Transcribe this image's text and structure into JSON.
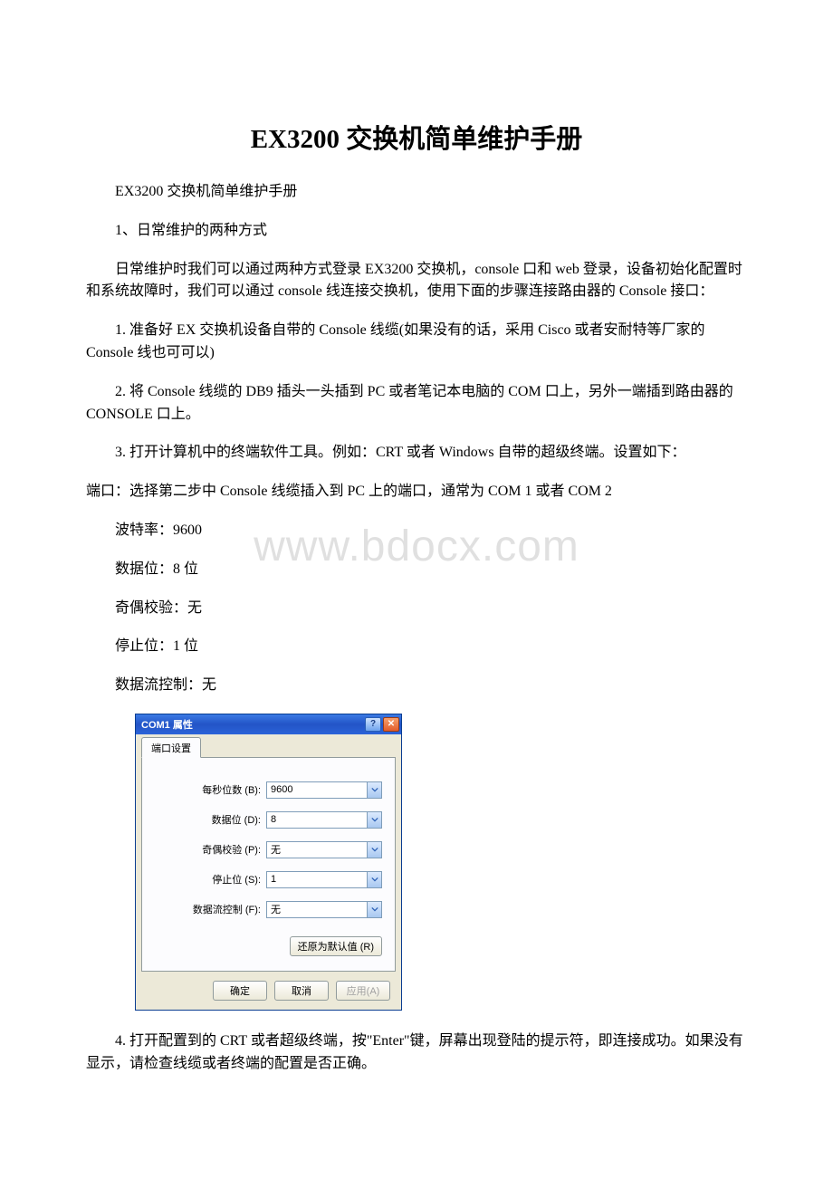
{
  "watermark": "www.bdocx.com",
  "title": "EX3200 交换机简单维护手册",
  "paragraphs": {
    "p1": "EX3200 交换机简单维护手册",
    "p2": "1、日常维护的两种方式",
    "p3": "日常维护时我们可以通过两种方式登录 EX3200 交换机，console 口和 web 登录，设备初始化配置时和系统故障时，我们可以通过 console 线连接交换机，使用下面的步骤连接路由器的 Console 接口：",
    "p4": "1. 准备好 EX 交换机设备自带的 Console 线缆(如果没有的话，采用 Cisco 或者安耐特等厂家的 Console 线也可可以)",
    "p5": "2. 将 Console 线缆的 DB9 插头一头插到 PC 或者笔记本电脑的 COM 口上，另外一端插到路由器的 CONSOLE 口上。",
    "p6": "3. 打开计算机中的终端软件工具。例如：CRT 或者 Windows 自带的超级终端。设置如下：",
    "p7": " 端口：选择第二步中 Console 线缆插入到 PC 上的端口，通常为 COM 1 或者 COM 2",
    "p8": " 波特率：9600",
    "p9": " 数据位：8 位",
    "p10": " 奇偶校验：无",
    "p11": " 停止位：1 位",
    "p12": " 数据流控制：无",
    "p13": "4. 打开配置到的 CRT 或者超级终端，按\"Enter\"键，屏幕出现登陆的提示符，即连接成功。如果没有显示，请检查线缆或者终端的配置是否正确。"
  },
  "dialog": {
    "title": "COM1 属性",
    "tab": "端口设置",
    "fields": {
      "bps": {
        "label": "每秒位数 (B):",
        "value": "9600"
      },
      "databits": {
        "label": "数据位 (D):",
        "value": "8"
      },
      "parity": {
        "label": "奇偶校验 (P):",
        "value": "无"
      },
      "stopbits": {
        "label": "停止位 (S):",
        "value": "1"
      },
      "flow": {
        "label": "数据流控制 (F):",
        "value": "无"
      }
    },
    "restore": "还原为默认值 (R)",
    "ok": "确定",
    "cancel": "取消",
    "apply": "应用(A)"
  }
}
